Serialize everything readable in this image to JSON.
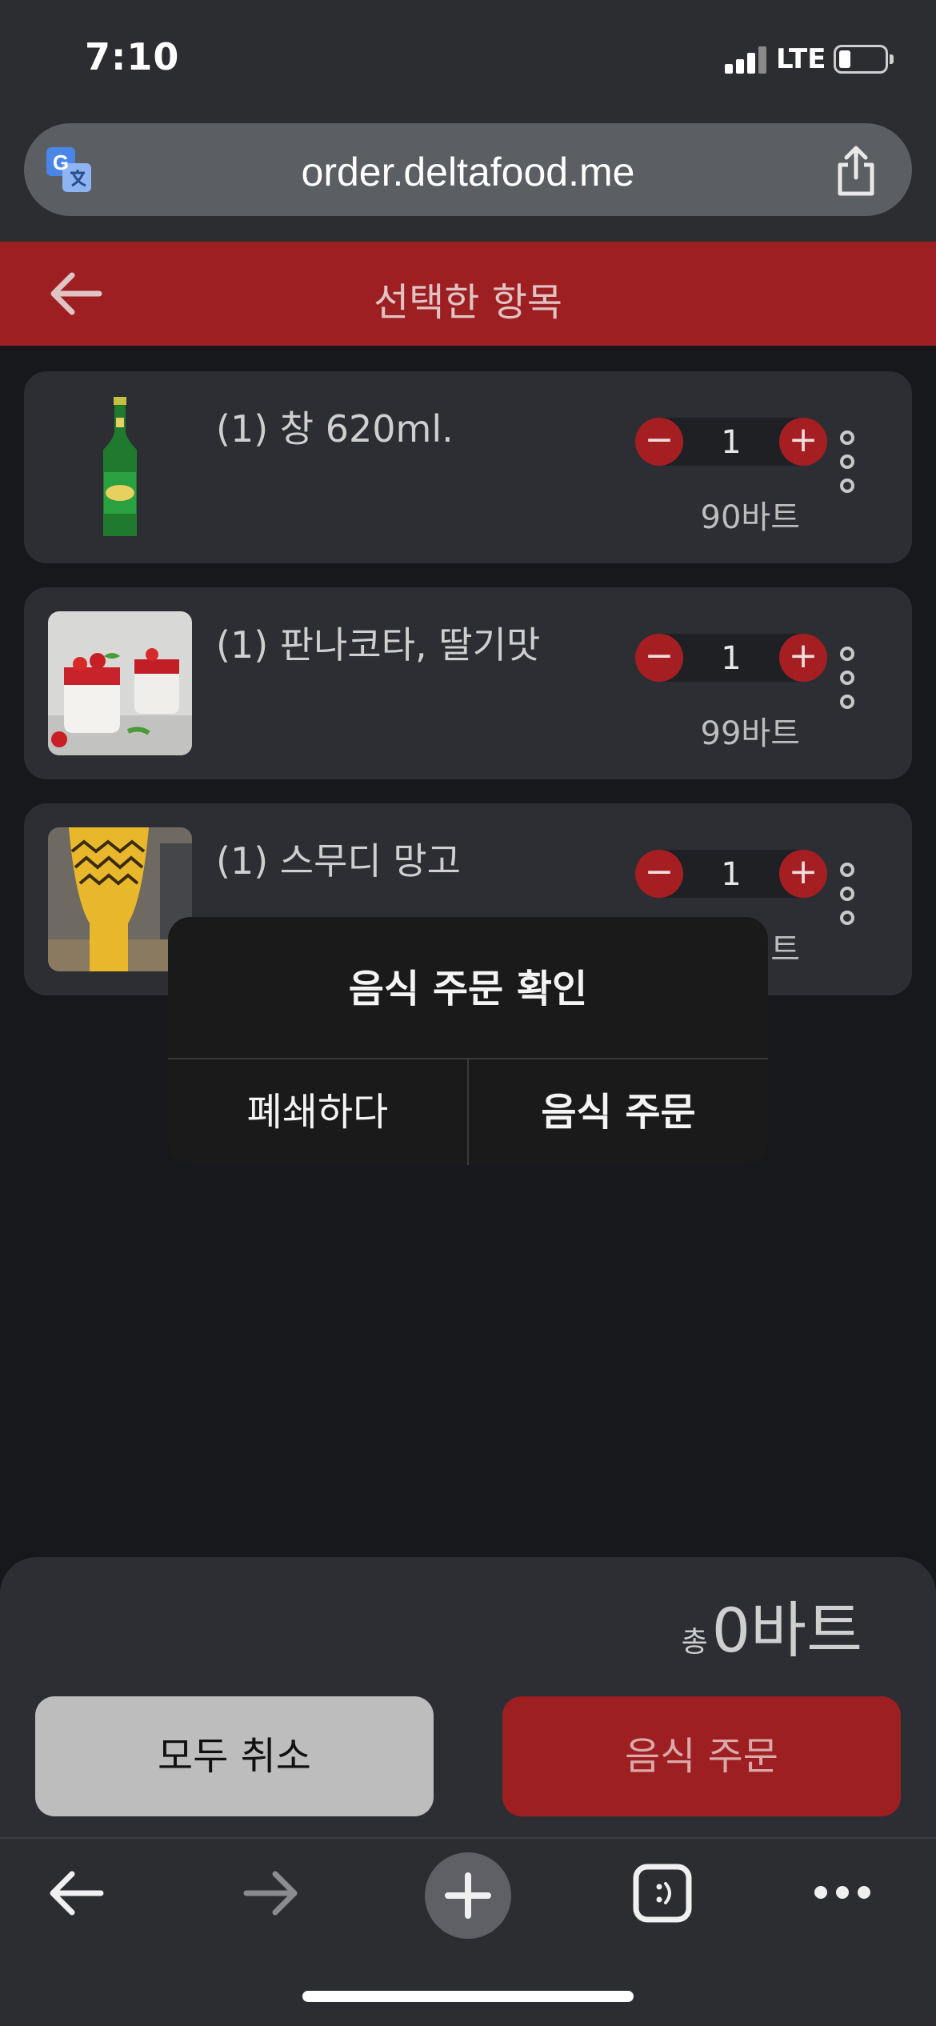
{
  "status_bar": {
    "time": "7:10",
    "network": "LTE"
  },
  "browser": {
    "url": "order.deltafood.me",
    "translate_icon": "translate-icon",
    "share_icon": "share-icon"
  },
  "header": {
    "title": "선택한 항목",
    "back_icon": "arrow-left-icon"
  },
  "cart": {
    "items": [
      {
        "name": "(1) 창 620ml.",
        "quantity": "1",
        "price": "90바트"
      },
      {
        "name": "(1) 판나코타, 딸기맛",
        "quantity": "1",
        "price": "99바트"
      },
      {
        "name": "(1) 스무디 망고",
        "quantity": "1",
        "price": "트"
      }
    ],
    "minus_symbol": "−",
    "plus_symbol": "+"
  },
  "dialog": {
    "title": "음식 주문 확인",
    "cancel_label": "폐쇄하다",
    "confirm_label": "음식 주문"
  },
  "summary": {
    "total_label": "총",
    "total_amount": "0바트"
  },
  "actions": {
    "cancel_all_label": "모두 취소",
    "order_label": "음식 주문"
  },
  "toolbar": {
    "icons": [
      "arrow-left-icon",
      "arrow-right-icon",
      "plus-icon",
      "tabs-icon",
      "more-icon"
    ]
  },
  "colors": {
    "brand_red": "#9e1f22",
    "surface": "#2d2e33",
    "background": "#17181c"
  }
}
